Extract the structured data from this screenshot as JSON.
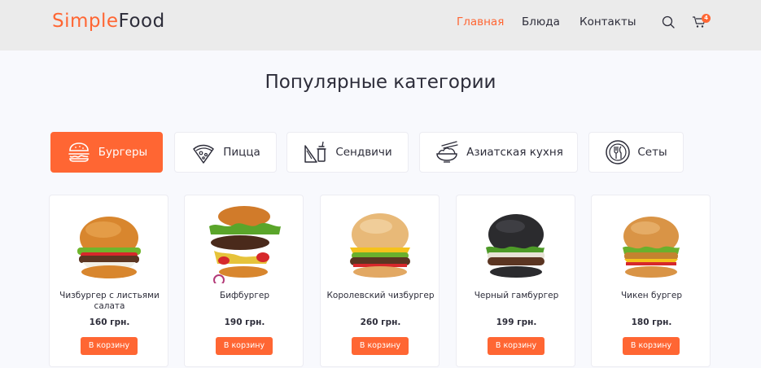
{
  "header": {
    "logo_part1": "Simple",
    "logo_part2": "Food",
    "nav": [
      "Главная",
      "Блюда",
      "Контакты"
    ],
    "cart_count": "4",
    "icons": [
      "search-icon",
      "cart-icon"
    ]
  },
  "page_title": "Популярные категории",
  "categories": [
    {
      "label": "Бургеры",
      "icon": "burger-icon",
      "active": true
    },
    {
      "label": "Пицца",
      "icon": "pizza-icon",
      "active": false
    },
    {
      "label": "Сендвичи",
      "icon": "sandwich-icon",
      "active": false
    },
    {
      "label": "Азиатская кухня",
      "icon": "asian-food-icon",
      "active": false
    },
    {
      "label": "Сеты",
      "icon": "plate-cutlery-icon",
      "active": false
    }
  ],
  "products": [
    {
      "name": "Чизбургер с листьями салата",
      "price": "160 грн.",
      "button": "В корзину"
    },
    {
      "name": "Бифбургер",
      "price": "190 грн.",
      "button": "В корзину"
    },
    {
      "name": "Королевский чизбургер",
      "price": "260 грн.",
      "button": "В корзину"
    },
    {
      "name": "Черный гамбургер",
      "price": "199 грн.",
      "button": "В корзину"
    },
    {
      "name": "Чикен бургер",
      "price": "180 грн.",
      "button": "В корзину"
    }
  ],
  "colors": {
    "accent": "#ff6633",
    "text": "#2d2d3a",
    "header_bg": "#ebebeb",
    "page_bg": "#f8f9fd"
  }
}
